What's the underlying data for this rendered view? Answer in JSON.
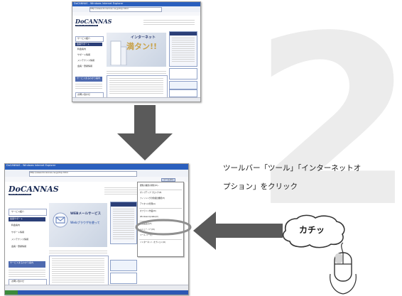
{
  "step_number": "2",
  "instruction": {
    "line1": "ツールバー「ツール」「インターネットオ",
    "line2": "プション」をクリック"
  },
  "click_label": "カチッ",
  "icons": {
    "down_arrow": "down-arrow-icon",
    "left_arrow": "left-arrow-icon",
    "mouse": "mouse-icon"
  },
  "colors": {
    "arrow": "#5a5a5a",
    "step_number": "#ececec",
    "highlight_ring": "#8f8f8f",
    "titlebar": "#2a5fbe"
  },
  "screenshot_before": {
    "window_title": "DoCANNAS - Windows Internet Explorer",
    "address": "http://www.docannas.ne.jp/top.html",
    "logo": "DoCANNAS",
    "logo_sub": "Internet Service Provider",
    "banner_title": "インターネット",
    "banner_big": "満タン!!",
    "side_header": "会員サポート",
    "side_items": [
      "サービス紹介",
      "会員サポート",
      "料金案内",
      "サポート情報",
      "メンテナンス情報",
      "会員・登録情報"
    ],
    "promo": "サービスまるわかり案内",
    "footer_link": "お問い合わせ"
  },
  "screenshot_after": {
    "window_title": "DoCANNAS - Windows Internet Explorer",
    "address": "http://www.docannas.ne.jp/top.html",
    "logo": "DoCANNAS",
    "logo_sub": "Internet Service Provider",
    "banner_title": "WEBメールサービス",
    "banner_big": "Webブラウザを使って",
    "side_header": "会員サポート",
    "side_items": [
      "サービス紹介",
      "会員サポート",
      "料金案内",
      "サポート情報",
      "メンテナンス情報",
      "会員・登録情報"
    ],
    "promo": "サービスまるわかり案内",
    "footer_link": "お問い合わせ",
    "tools_menu_label": "ツール(O)",
    "menu_items": [
      "閲覧の履歴の削除(D)...",
      "ポップアップ ブロック(P)",
      "フィッシング詐欺検出機能(H)",
      "アドオンの管理(A)",
      "オフライン作業(W)",
      "Windows Update(U)",
      "全画面表示(F)",
      "メニュー バー(M)",
      "ツール バー(T)",
      "インターネット オプション(O)"
    ],
    "highlighted_item": "インターネット オプション(O)"
  }
}
